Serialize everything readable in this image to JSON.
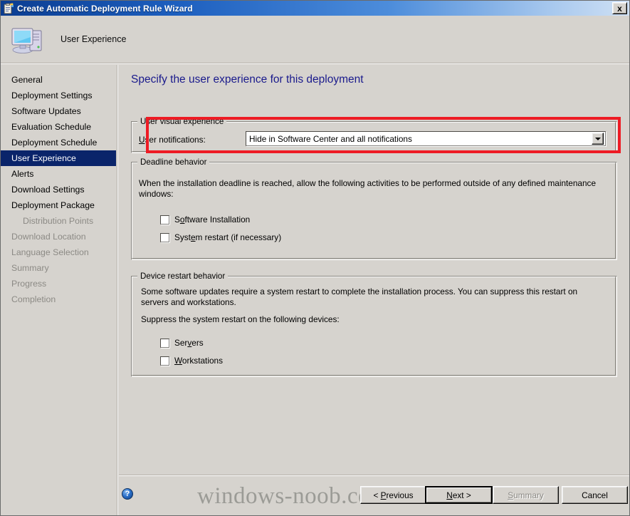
{
  "window": {
    "title": "Create Automatic Deployment Rule Wizard",
    "title_icon": "wizard-clipboard-icon",
    "close_label": "x"
  },
  "header": {
    "icon": "computer-icon",
    "title": "User Experience"
  },
  "sidebar": {
    "items": [
      {
        "label": "General",
        "state": "enabled",
        "indent": false
      },
      {
        "label": "Deployment Settings",
        "state": "enabled",
        "indent": false
      },
      {
        "label": "Software Updates",
        "state": "enabled",
        "indent": false
      },
      {
        "label": "Evaluation Schedule",
        "state": "enabled",
        "indent": false
      },
      {
        "label": "Deployment Schedule",
        "state": "enabled",
        "indent": false
      },
      {
        "label": "User Experience",
        "state": "selected",
        "indent": false
      },
      {
        "label": "Alerts",
        "state": "enabled",
        "indent": false
      },
      {
        "label": "Download Settings",
        "state": "enabled",
        "indent": false
      },
      {
        "label": "Deployment Package",
        "state": "enabled",
        "indent": false
      },
      {
        "label": "Distribution Points",
        "state": "disabled",
        "indent": true
      },
      {
        "label": "Download Location",
        "state": "disabled",
        "indent": false
      },
      {
        "label": "Language Selection",
        "state": "disabled",
        "indent": false
      },
      {
        "label": "Summary",
        "state": "disabled",
        "indent": false
      },
      {
        "label": "Progress",
        "state": "disabled",
        "indent": false
      },
      {
        "label": "Completion",
        "state": "disabled",
        "indent": false
      }
    ]
  },
  "main": {
    "page_title": "Specify the user experience for this deployment",
    "visual_experience": {
      "legend": "User visual experience",
      "notifications_label": "User notifications:",
      "notifications_accelerator": "U",
      "notifications_value": "Hide in Software Center and all notifications",
      "highlight_color": "#ee1b24"
    },
    "deadline_behavior": {
      "legend": "Deadline behavior",
      "description": "When the installation deadline is reached, allow the following activities to be performed outside of any defined maintenance windows:",
      "checkboxes": [
        {
          "label": "Software Installation",
          "checked": false
        },
        {
          "label": "System restart (if necessary)",
          "checked": false
        }
      ]
    },
    "device_restart_behavior": {
      "legend": "Device restart behavior",
      "description": "Some software updates require a system restart to complete the installation process.  You can suppress this restart on servers and workstations.",
      "subprompt": "Suppress the system restart on the following devices:",
      "checkboxes": [
        {
          "label": "Servers",
          "checked": false
        },
        {
          "label": "Workstations",
          "checked": false
        }
      ]
    }
  },
  "footer": {
    "help_icon": "help-question-icon",
    "watermark": "windows-noob.com",
    "buttons": [
      {
        "label": "< Previous",
        "state": "enabled"
      },
      {
        "label": "Next >",
        "state": "default"
      },
      {
        "label": "Summary",
        "state": "disabled"
      },
      {
        "label": "Cancel",
        "state": "enabled"
      }
    ]
  }
}
